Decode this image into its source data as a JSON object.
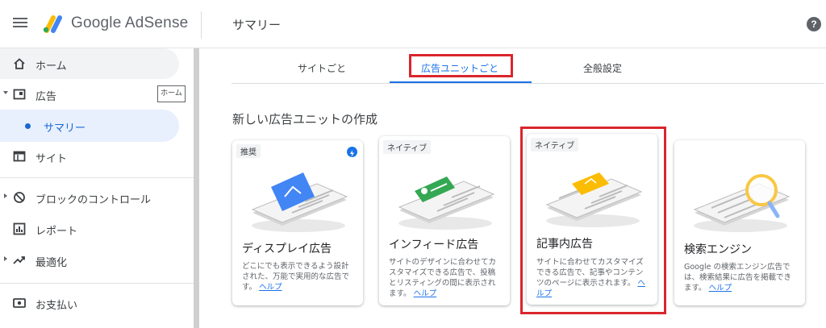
{
  "app": {
    "brand": "Google AdSense",
    "page_title": "サマリー",
    "help_glyph": "?"
  },
  "sidebar": {
    "items": [
      {
        "label": "ホーム",
        "icon": "home-icon"
      },
      {
        "label": "広告",
        "icon": "ads-icon",
        "chip": "ホーム"
      },
      {
        "label": "サマリー"
      },
      {
        "label": "サイト",
        "icon": "site-icon"
      },
      {
        "label": "ブロックのコントロール",
        "icon": "block-icon"
      },
      {
        "label": "レポート",
        "icon": "report-icon"
      },
      {
        "label": "最適化",
        "icon": "trend-icon"
      },
      {
        "label": "お支払い",
        "icon": "payment-icon"
      }
    ]
  },
  "tabs": [
    {
      "label": "サイトごと"
    },
    {
      "label": "広告ユニットごと",
      "active": true
    },
    {
      "label": "全般設定"
    }
  ],
  "section_title": "新しい広告ユニットの作成",
  "cards": [
    {
      "badge": "推奨",
      "title": "ディスプレイ広告",
      "desc": "どこにでも表示できるよう設計された、万能で実用的な広告です。",
      "link": "ヘルプ"
    },
    {
      "badge": "ネイティブ",
      "title": "インフィード広告",
      "desc": "サイトのデザインに合わせてカスタマイズできる広告で、投稿とリスティングの間に表示されます。",
      "link": "ヘルプ"
    },
    {
      "badge": "ネイティブ",
      "title": "記事内広告",
      "desc": "サイトに合わせてカスタマイズできる広告で、記事やコンテンツのページに表示されます。",
      "link": "ヘルプ"
    },
    {
      "title": "検索エンジン",
      "desc": "Google の検索エンジン広告では、検索結果に広告を掲載できます。",
      "link": "ヘルプ"
    }
  ],
  "colors": {
    "accent": "#1a73e8",
    "highlight_red": "#d9262c",
    "active_bg": "#e8f0fe"
  }
}
